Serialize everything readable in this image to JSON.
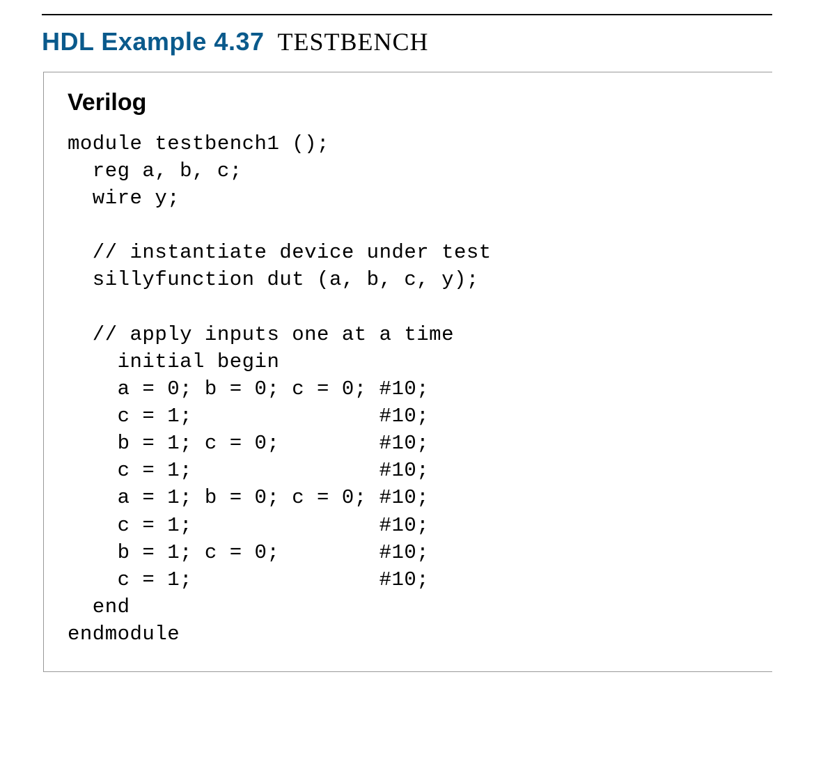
{
  "heading": {
    "label": "HDL Example 4.37",
    "title": "TESTBENCH"
  },
  "language_label": "Verilog",
  "code_lines": [
    "module testbench1 ();",
    "  reg a, b, c;",
    "  wire y;",
    "",
    "  // instantiate device under test",
    "  sillyfunction dut (a, b, c, y);",
    "",
    "  // apply inputs one at a time",
    "    initial begin",
    "    a = 0; b = 0; c = 0; #10;",
    "    c = 1;               #10;",
    "    b = 1; c = 0;        #10;",
    "    c = 1;               #10;",
    "    a = 1; b = 0; c = 0; #10;",
    "    c = 1;               #10;",
    "    b = 1; c = 0;        #10;",
    "    c = 1;               #10;",
    "  end",
    "endmodule"
  ]
}
